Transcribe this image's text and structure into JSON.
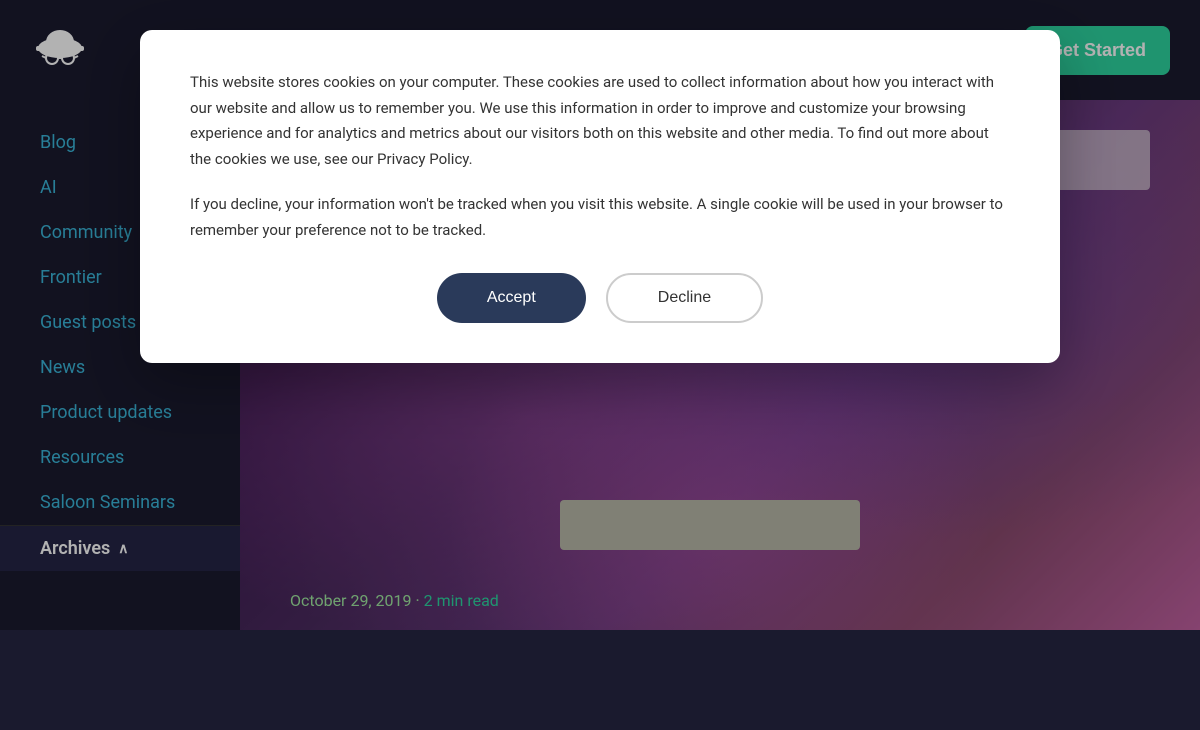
{
  "header": {
    "logo_alt": "Cowboy AI Logo",
    "get_started_label": "Get Started"
  },
  "sidebar": {
    "items": [
      {
        "label": "Blog",
        "id": "blog"
      },
      {
        "label": "AI",
        "id": "ai"
      },
      {
        "label": "Community",
        "id": "community"
      },
      {
        "label": "Frontier",
        "id": "frontier"
      },
      {
        "label": "Guest posts",
        "id": "guest-posts"
      },
      {
        "label": "News",
        "id": "news"
      },
      {
        "label": "Product updates",
        "id": "product-updates"
      },
      {
        "label": "Resources",
        "id": "resources"
      },
      {
        "label": "Saloon Seminars",
        "id": "saloon-seminars"
      }
    ],
    "archives_label": "Archives",
    "archives_chevron": "∧"
  },
  "article": {
    "date": "October 29, 2019 · ",
    "read_time": "2 min read"
  },
  "cookie_modal": {
    "text1": "This website stores cookies on your computer. These cookies are used to collect information about how you interact with our website and allow us to remember you. We use this information in order to improve and customize your browsing experience and for analytics and metrics about our visitors both on this website and other media. To find out more about the cookies we use, see our Privacy Policy.",
    "text2": "If you decline, your information won't be tracked when you visit this website. A single cookie will be used in your browser to remember your preference not to be tracked.",
    "accept_label": "Accept",
    "decline_label": "Decline"
  }
}
